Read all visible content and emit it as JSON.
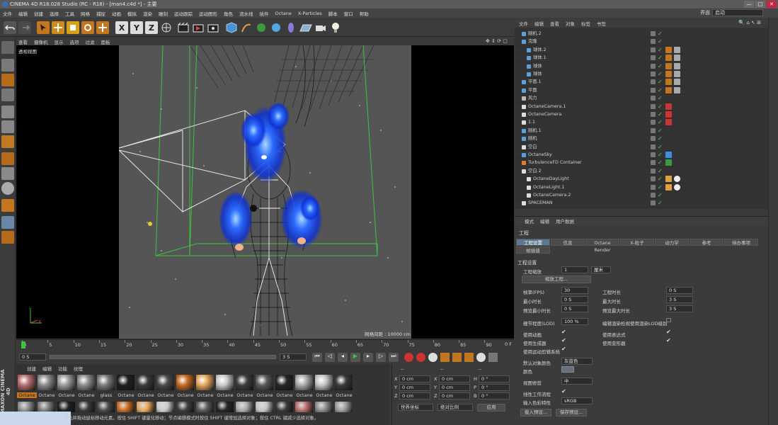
{
  "window": {
    "title": "CINEMA 4D R18.028 Studio (RC - R18) - [man4.c4d *] - 主要",
    "controls": [
      "—",
      "□",
      "✕"
    ]
  },
  "menubar": [
    "文件",
    "编辑",
    "创建",
    "选择",
    "工具",
    "网格",
    "捕捉",
    "动画",
    "模拟",
    "渲染",
    "雕刻",
    "运动跟踪",
    "运动图形",
    "角色",
    "流水线",
    "插件",
    "Octane",
    "X-Particles",
    "脚本",
    "窗口",
    "帮助"
  ],
  "layout": {
    "label": "界面",
    "value": "启动"
  },
  "toolbar": {
    "x_label": "X",
    "y_label": "Y",
    "z_label": "Z"
  },
  "viewport": {
    "menu": [
      "查看",
      "摄像机",
      "显示",
      "选项",
      "过滤",
      "面板"
    ],
    "label": "透视视图",
    "grid_info": "网格间距 : 10000 cm",
    "axis": {
      "y": "Y",
      "x": "X"
    }
  },
  "timeline": {
    "ticks": [
      "0",
      "5",
      "10",
      "15",
      "20",
      "25",
      "30",
      "35",
      "40",
      "45",
      "50",
      "55",
      "60",
      "65",
      "70",
      "75",
      "80",
      "85",
      "90"
    ],
    "end_frame": "0 F",
    "current": "0 F",
    "field_start": "0 S",
    "field_end": "3 S"
  },
  "material": {
    "menu": [
      "创建",
      "编辑",
      "功能",
      "纹理"
    ],
    "labels_row1": [
      "Octane",
      "Octane",
      "Octane",
      "Octane",
      "glass",
      "Octane",
      "Octane",
      "Octane",
      "Octane",
      "Octane",
      "Octane",
      "Octane",
      "Octane",
      "Octane",
      "Octane",
      "Octane",
      "Octane"
    ],
    "colors_row1": [
      "#b96e6e",
      "#8a8a8a",
      "#9a9a9a",
      "#8c8c8c",
      "#7a7a7a",
      "#202020",
      "#3a3a3a",
      "#4a4a4a",
      "#c56a22",
      "#e5a65a",
      "#c9c9c9",
      "#3e3e3e",
      "#5a5a5a",
      "#262626",
      "#aaaaaa",
      "#c5c5c5",
      "#3a3a3a"
    ]
  },
  "coords": {
    "header": [
      "--",
      "--",
      "--"
    ],
    "rows": [
      {
        "a": "X",
        "v1": "0 cm",
        "b": "X",
        "v2": "0 cm",
        "c": "H",
        "v3": "0 °"
      },
      {
        "a": "Y",
        "v1": "0 cm",
        "b": "Y",
        "v2": "0 cm",
        "c": "P",
        "v3": "0 °"
      },
      {
        "a": "Z",
        "v1": "0 cm",
        "b": "Z",
        "v2": "0 cm",
        "c": "B",
        "v3": "0 °"
      }
    ],
    "mode1": "世界坐标",
    "mode2": "绝对比例",
    "apply": "应用"
  },
  "objects": {
    "menu": [
      "文件",
      "编辑",
      "查看",
      "对象",
      "标签",
      "书签"
    ],
    "items": [
      {
        "name": "随机.2",
        "indent": 1,
        "icon": "#5aa0dc"
      },
      {
        "name": "克隆",
        "indent": 1,
        "icon": "#5aa0dc"
      },
      {
        "name": "球体.2",
        "indent": 2,
        "icon": "#5aa0dc"
      },
      {
        "name": "球体.1",
        "indent": 2,
        "icon": "#5aa0dc"
      },
      {
        "name": "球体",
        "indent": 2,
        "icon": "#5aa0dc"
      },
      {
        "name": "球体",
        "indent": 2,
        "icon": "#5aa0dc"
      },
      {
        "name": "平面.1",
        "indent": 1,
        "icon": "#5aa0dc"
      },
      {
        "name": "平面",
        "indent": 1,
        "icon": "#5aa0dc"
      },
      {
        "name": "风力",
        "indent": 1,
        "icon": "#bbbbbb"
      },
      {
        "name": "OctaneCamera.1",
        "indent": 1,
        "icon": "#dddddd"
      },
      {
        "name": "OctaneCamera",
        "indent": 1,
        "icon": "#dddddd"
      },
      {
        "name": "1.1",
        "indent": 1,
        "icon": "#dddddd"
      },
      {
        "name": "随机.1",
        "indent": 1,
        "icon": "#5aa0dc"
      },
      {
        "name": "随机",
        "indent": 1,
        "icon": "#5aa0dc"
      },
      {
        "name": "空白",
        "indent": 1,
        "icon": "#dddddd"
      },
      {
        "name": "OctaneSky",
        "indent": 1,
        "icon": "#5aa0dc"
      },
      {
        "name": "TurbulenceFD Container",
        "indent": 1,
        "icon": "#e07a2a"
      },
      {
        "name": "空白.2",
        "indent": 1,
        "icon": "#dddddd"
      },
      {
        "name": "OctaneDayLight",
        "indent": 2,
        "icon": "#dddddd"
      },
      {
        "name": "OctaneLight.1",
        "indent": 2,
        "icon": "#dddddd"
      },
      {
        "name": "OctaneCamera.2",
        "indent": 2,
        "icon": "#dddddd"
      },
      {
        "name": "SPACEMAN",
        "indent": 1,
        "icon": "#dddddd"
      }
    ]
  },
  "attributes": {
    "menu": [
      "模式",
      "编辑",
      "用户数据"
    ],
    "title": "工程",
    "tabs": [
      "工程设置",
      "信息",
      "Octane Render",
      "X-粒子",
      "动力学",
      "参考",
      "待办事项",
      "帧插值"
    ],
    "section": "工程设置",
    "project_scale_label": "工程缩放",
    "project_scale_value": "1",
    "project_scale_unit": "厘米",
    "scale_button": "缩放工程...",
    "fps_label": "帧率(FPS)",
    "fps_value": "30",
    "project_length_label": "工程时长",
    "project_length_value": "0 S",
    "min_time_label": "最小时长",
    "min_time_value": "0 S",
    "max_time_label": "最大时长",
    "max_time_value": "3 S",
    "preview_min_label": "预览最小时长",
    "preview_min_value": "0 S",
    "preview_max_label": "预览最大时长",
    "preview_max_value": "3 S",
    "lod_label": "细节程度(LOD)",
    "lod_value": "100 %",
    "lod_render_label": "编辑渲染检视使用渲染LOD级别",
    "use_anim": "使用动画",
    "use_expr": "使用表达式",
    "use_gen": "使用生成器",
    "use_deform": "使用变形器",
    "use_motion": "使用运动剪辑系统",
    "default_color_label": "默认对象颜色",
    "default_color_value": "灰蓝色",
    "color_label": "颜色",
    "view_clip_label": "视图修剪",
    "view_clip_value": "中",
    "linear_label": "线性工作流程",
    "input_color_label": "输入色彩特性",
    "input_color_value": "sRGB",
    "load_preset": "载入预设...",
    "save_preset": "保存预设..."
  },
  "status": "单击并拖动鼠标移动元素。按住 SHIFT 键量化移动；节点编辑模式时按住 SHIFT 键增加选择对象；按住 CTRL 键减少选择对象。",
  "brand": "MAXON CINEMA 4D"
}
